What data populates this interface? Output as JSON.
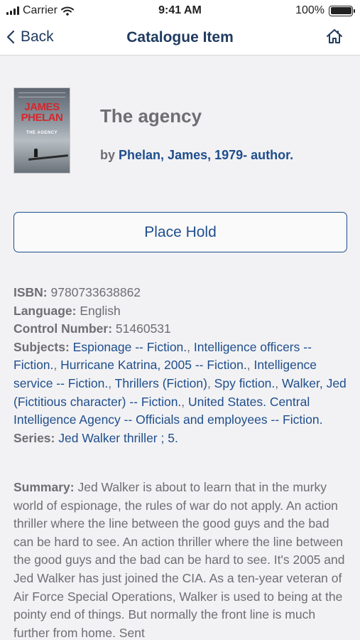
{
  "status_bar": {
    "carrier": "Carrier",
    "time": "9:41 AM",
    "battery": "100%",
    "battery_level": 1.0
  },
  "nav": {
    "back_label": "Back",
    "title": "Catalogue Item",
    "home_icon": "home-icon"
  },
  "cover": {
    "author_text": "JAMES PHELAN",
    "title_text": "THE AGENCY"
  },
  "item": {
    "title": "The agency",
    "by_label": "by",
    "author": "Phelan, James, 1979- author."
  },
  "actions": {
    "place_hold": "Place Hold"
  },
  "details": {
    "isbn_label": "ISBN:",
    "isbn": "9780733638862",
    "language_label": "Language:",
    "language": "English",
    "control_label": "Control Number:",
    "control_number": "51460531",
    "subjects_label": "Subjects:",
    "subjects": [
      "Espionage -- Fiction.",
      "Intelligence officers -- Fiction.",
      "Hurricane Katrina, 2005 -- Fiction.",
      "Intelligence service -- Fiction.",
      "Thrillers (Fiction)",
      "Spy fiction.",
      "Walker, Jed (Fictitious character) -- Fiction.",
      "United States. Central Intelligence Agency -- Officials and employees -- Fiction."
    ],
    "series_label": "Series:",
    "series": "Jed Walker thriller ; 5."
  },
  "summary": {
    "label": "Summary:",
    "text": "Jed Walker is about to learn that in the murky world of espionage, the rules of war do not apply. An action thriller where the line between the good guys and the bad can be hard to see. An action thriller where the line between the good guys and the bad can be hard to see. It's 2005 and Jed Walker has just joined the CIA. As a ten-year veteran of Air Force Special Operations, Walker is used to being at the pointy end of things. But normally the front line is much further from home. Sent"
  }
}
